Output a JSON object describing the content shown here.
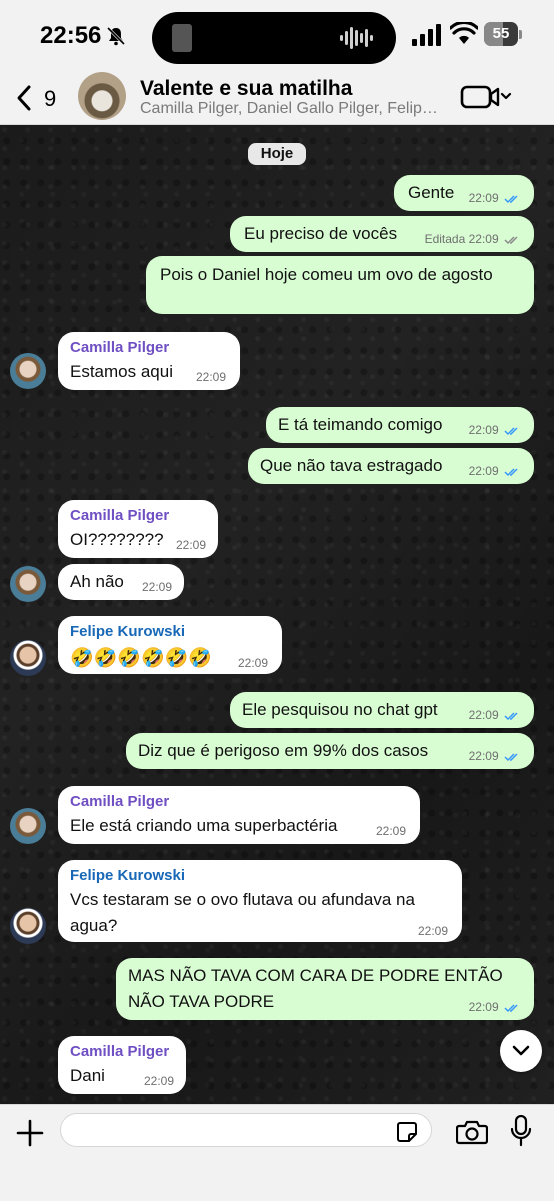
{
  "status_bar": {
    "time": "22:56",
    "battery": "55"
  },
  "header": {
    "back_count": "9",
    "title": "Valente e sua matilha",
    "members": "Camilla Pilger, Daniel Gallo Pilger, Felipe Kurowski"
  },
  "date_chip": "Hoje",
  "messages": [
    {
      "text": "Gente",
      "time": "22:09"
    },
    {
      "text": "Eu preciso de vocês",
      "edited": "Editada",
      "time": "22:09"
    },
    {
      "text": "Pois o Daniel hoje comeu um ovo de agosto",
      "time": ""
    },
    {
      "sender": "Camilla Pilger",
      "text": "Estamos aqui",
      "time": "22:09"
    },
    {
      "text": "E tá teimando comigo",
      "time": "22:09"
    },
    {
      "text": "Que não tava estragado",
      "time": "22:09"
    },
    {
      "sender": "Camilla Pilger",
      "text": "OI????????",
      "time": "22:09"
    },
    {
      "text": "Ah não",
      "time": "22:09"
    },
    {
      "sender": "Felipe Kurowski",
      "text": "🤣🤣🤣🤣🤣🤣",
      "time": "22:09"
    },
    {
      "text": "Ele pesquisou no chat gpt",
      "time": "22:09"
    },
    {
      "text": "Diz que é perigoso em 99% dos casos",
      "time": "22:09"
    },
    {
      "sender": "Camilla Pilger",
      "text": "Ele está criando uma superbactéria",
      "time": "22:09"
    },
    {
      "sender": "Felipe Kurowski",
      "text_line1": "Vcs testaram se o ovo flutava ou afundava na",
      "text_line2": "agua?",
      "time": "22:09"
    },
    {
      "text_line1": "MAS NÃO TAVA COM CARA DE PODRE ENTÃO",
      "text_line2": "NÃO TAVA PODRE",
      "time": "22:09"
    },
    {
      "sender": "Camilla Pilger",
      "text": "Dani",
      "time": "22:09"
    }
  ],
  "composer": {
    "value": "",
    "placeholder": ""
  },
  "colors": {
    "outgoing_bubble": "#d9fdd3",
    "incoming_bubble": "#ffffff",
    "read_ticks": "#3497f9",
    "camilla_name": "#6f4fc2",
    "felipe_name": "#1868b7"
  },
  "icons": [
    "bell-slash-icon",
    "signal-icon",
    "wifi-icon",
    "battery-icon",
    "back-chevron-icon",
    "video-call-icon",
    "chevron-down-icon",
    "plus-icon",
    "sticker-icon",
    "camera-icon",
    "microphone-icon"
  ]
}
